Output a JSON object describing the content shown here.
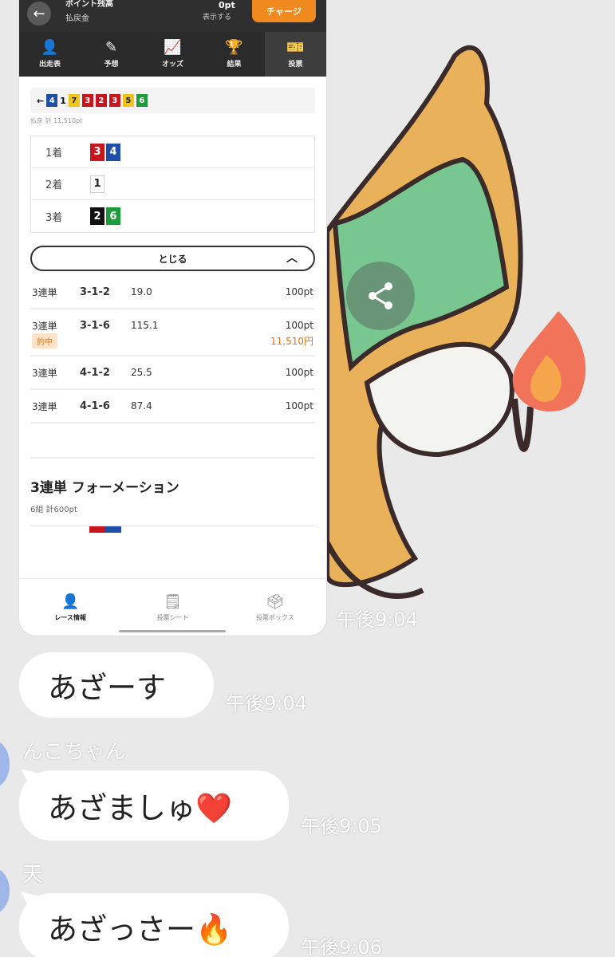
{
  "screenshot": {
    "header": {
      "title": "ポイント残高",
      "subtitle": "払戻金",
      "points": "0pt",
      "show_label": "表示する",
      "charge_button": "チャージ"
    },
    "tabs": [
      {
        "label": "出走表",
        "icon": "person-icon"
      },
      {
        "label": "予想",
        "icon": "prediction-icon"
      },
      {
        "label": "オッズ",
        "icon": "chart-icon"
      },
      {
        "label": "結果",
        "icon": "trophy-icon"
      },
      {
        "label": "投票",
        "icon": "ticket-icon"
      }
    ],
    "result_strip": {
      "prefix": "1",
      "note": "払戻 計 11,510pt"
    },
    "ranks": [
      {
        "label": "1着",
        "nums": [
          "3",
          "4"
        ]
      },
      {
        "label": "2着",
        "nums": [
          "1"
        ]
      },
      {
        "label": "3着",
        "nums": [
          "2",
          "6"
        ]
      }
    ],
    "close_button": "とじる",
    "bets": [
      {
        "type": "3連単",
        "combo": "3-1-2",
        "odds": "19.0",
        "amount": "100pt",
        "hit": false
      },
      {
        "type": "3連単",
        "combo": "3-1-6",
        "odds": "115.1",
        "amount": "100pt",
        "hit": true,
        "hit_label": "的中",
        "payout": "11,510円"
      },
      {
        "type": "3連単",
        "combo": "4-1-2",
        "odds": "25.5",
        "amount": "100pt",
        "hit": false
      },
      {
        "type": "3連単",
        "combo": "4-1-6",
        "odds": "87.4",
        "amount": "100pt",
        "hit": false
      }
    ],
    "section_title": "3連単 フォーメーション",
    "section_sub": "6組 計600pt",
    "bottom_nav": [
      {
        "label": "レース情報",
        "icon": "person-icon"
      },
      {
        "label": "投票シート",
        "icon": "sheet-icon"
      },
      {
        "label": "投票ボックス",
        "icon": "box-icon"
      }
    ]
  },
  "chat": {
    "screenshot_time": "午後9:04",
    "messages": [
      {
        "sender": "",
        "text": "あざーす",
        "time": "午後9:04"
      },
      {
        "sender": "んこちゃん",
        "text": "あざましゅ❤️",
        "time": "午後9:05"
      },
      {
        "sender": "天",
        "text": "あざっさー🔥",
        "time": "午後9:06"
      }
    ]
  },
  "colors": {
    "chat_bg": "#e9e9e9",
    "app_dark": "#2f2f2f",
    "accent_orange": "#f08a1f",
    "hit_orange": "#e07412",
    "avatar_blue": "#9fb6e8"
  }
}
